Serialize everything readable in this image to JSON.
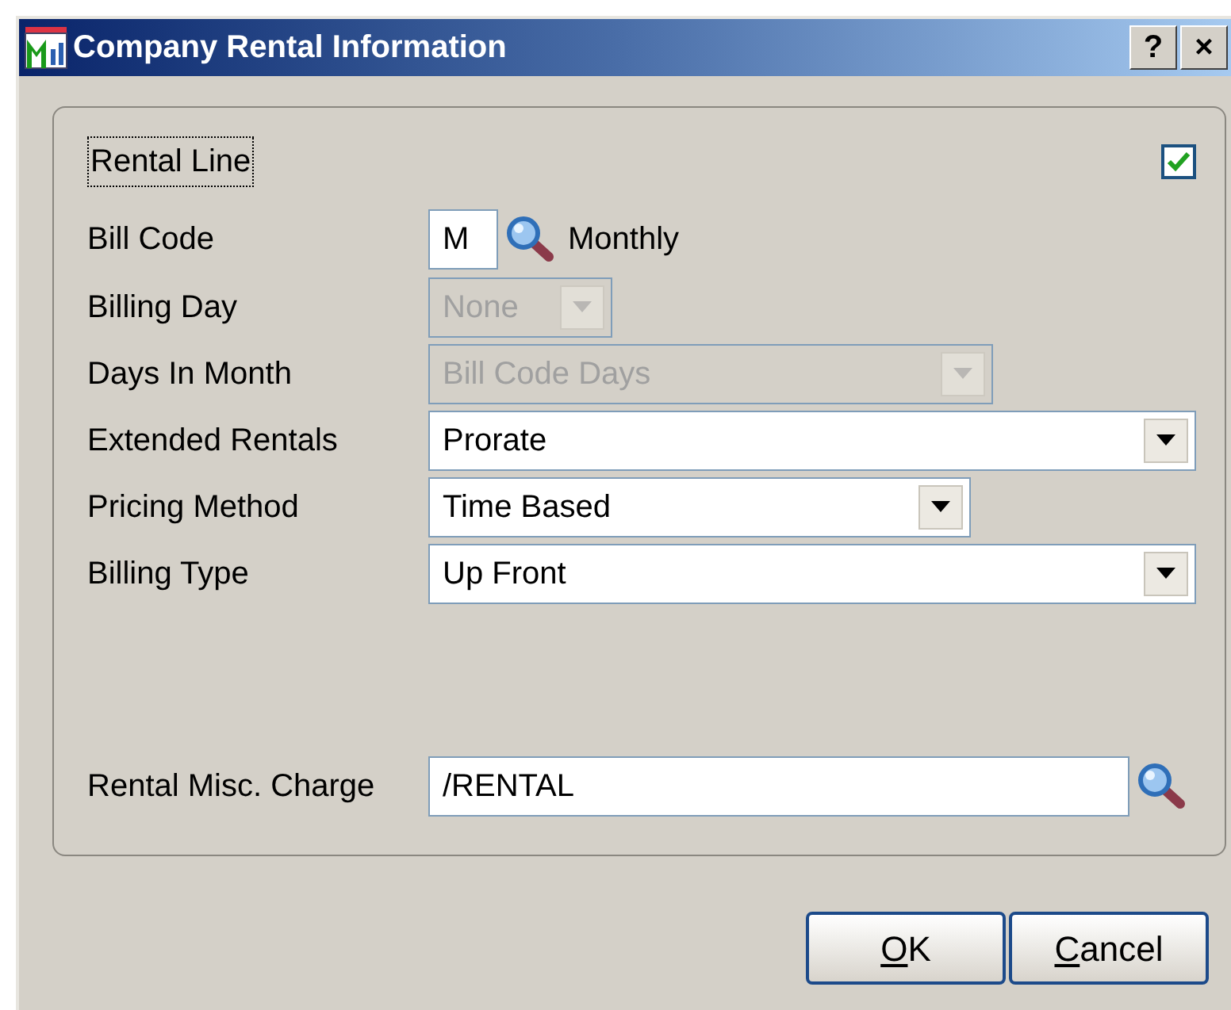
{
  "window": {
    "title": "Company Rental Information",
    "title_buttons": [
      "?",
      "×"
    ]
  },
  "rental_line": {
    "label": "Rental Line",
    "checked": true
  },
  "fields": [
    {
      "label": "Bill Code",
      "kind": "code",
      "value": "M",
      "disabled": false,
      "description": "Monthly"
    },
    {
      "label": "Billing Day",
      "kind": "combo",
      "value": "None",
      "disabled": true
    },
    {
      "label": "Days In Month",
      "kind": "combo",
      "value": "Bill Code Days",
      "disabled": true
    },
    {
      "label": "Extended Rentals",
      "kind": "combo",
      "value": "Prorate",
      "disabled": false
    },
    {
      "label": "Pricing Method",
      "kind": "combo",
      "value": "Time Based",
      "disabled": false
    },
    {
      "label": "Billing Type",
      "kind": "combo",
      "value": "Up Front",
      "disabled": false
    },
    {
      "label": "Rental Misc. Charge",
      "kind": "lookup",
      "value": "/RENTAL",
      "disabled": false
    }
  ],
  "buttons": [
    {
      "mnemonic": "O",
      "rest": "K"
    },
    {
      "mnemonic": "C",
      "rest": "ancel"
    }
  ]
}
